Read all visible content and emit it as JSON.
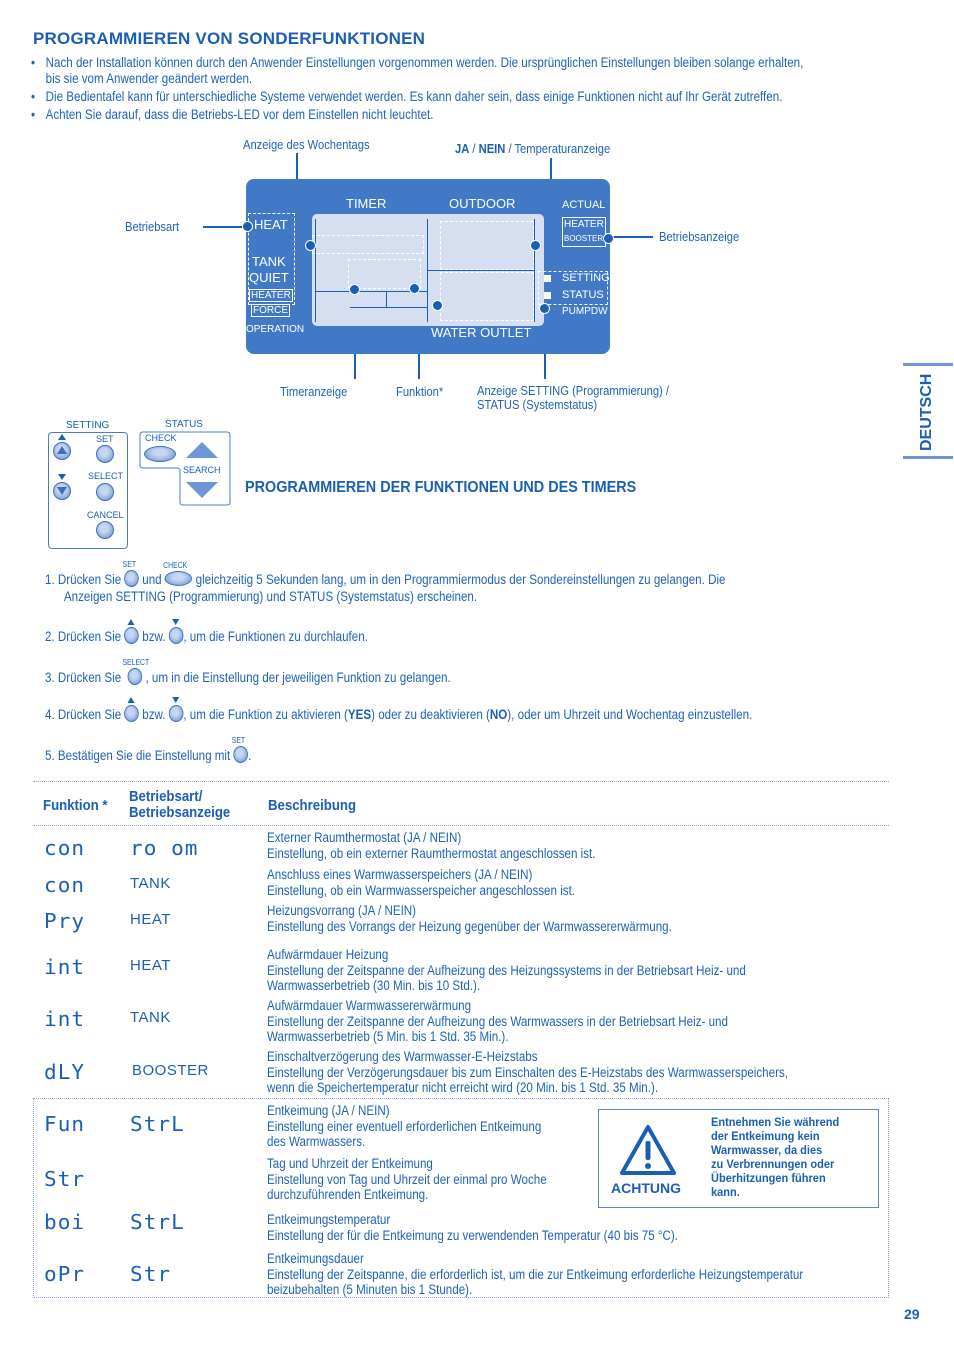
{
  "title": "PROGRAMMIEREN VON SONDERFUNKTIONEN",
  "bullets": [
    "Nach der Installation können durch den Anwender Einstellungen vorgenommen werden. Die ursprünglichen Einstellungen bleiben solange erhalten,",
    "bis sie vom Anwender geändert werden.",
    "Die Bedientafel kann für unterschiedliche Systeme verwendet werden. Es kann daher sein, dass einige Funktionen nicht auf Ihr Gerät zutreffen.",
    "Achten Sie darauf, dass die Betriebs-LED vor dem Einstellen nicht leuchtet."
  ],
  "diagram": {
    "callouts": {
      "weekday": "Anzeige des Wochentags",
      "yes_no_bold_ja": "JA",
      "yes_no_sep1": " / ",
      "yes_no_bold_nein": "NEIN",
      "yes_no_rest": " / Temperaturanzeige",
      "operation_mode": "Betriebsart",
      "operation_indicator": "Betriebsanzeige",
      "timer_display": "Timeranzeige",
      "function": "Funktion*",
      "setting_status_line1": "Anzeige SETTING (Programmierung) /",
      "setting_status_line2": "STATUS (Systemstatus)"
    },
    "lcd": {
      "timer": "TIMER",
      "outdoor": "OUTDOOR",
      "actual": "ACTUAL",
      "heat": "HEAT",
      "tank": "TANK",
      "quiet": "QUIET",
      "heater_left": "HEATER",
      "force": "FORCE",
      "operation": "OPERATION",
      "heater_right": "HEATER",
      "booster": "BOOSTER",
      "setting": "SETTING",
      "status": "STATUS",
      "pumpdw": "PUMPDW",
      "water_outlet": "WATER OUTLET"
    }
  },
  "buttons_panel": {
    "setting_title": "SETTING",
    "set": "SET",
    "select": "SELECT",
    "cancel": "CANCEL",
    "status_title": "STATUS",
    "check": "CHECK",
    "search": "SEARCH"
  },
  "subtitle": "PROGRAMMIEREN DER FUNKTIONEN UND DES TIMERS",
  "steps": {
    "s1_a": "1.  Drücken Sie",
    "s1_b": "und",
    "s1_c": "gleichzeitig 5 Sekunden lang, um in den Programmiermodus der Sondereinstellungen zu gelangen. Die",
    "s1_d": "Anzeigen SETTING (Programmierung) und STATUS (Systemstatus) erscheinen.",
    "s1_cap_set": "SET",
    "s1_cap_check": "CHECK",
    "s2_a": "2.  Drücken Sie",
    "s2_b": "bzw.",
    "s2_c": ", um die Funktionen zu durchlaufen.",
    "s3_a": "3.  Drücken Sie",
    "s3_cap": "SELECT",
    "s3_b": ", um in die Einstellung der jeweiligen Funktion zu gelangen.",
    "s4_a": "4.  Drücken Sie",
    "s4_b": "bzw.",
    "s4_c": ", um die Funktion zu aktivieren (",
    "s4_yes": "YES",
    "s4_d": ") oder zu deaktivieren (",
    "s4_no": "NO",
    "s4_e": "), oder um Uhrzeit und Wochentag einzustellen.",
    "s5_a": "5.  Bestätigen Sie die Einstellung mit",
    "s5_cap": "SET",
    "s5_b": "."
  },
  "table": {
    "headers": {
      "function": "Funktion *",
      "mode_line1": "Betriebsart/",
      "mode_line2": "Betriebsanzeige",
      "description": "Beschreibung"
    },
    "rows": [
      {
        "code": "con",
        "mode": "ro om",
        "mode_is_segment": true,
        "desc": "Externer Raumthermostat (JA / NEIN)\nEinstellung, ob ein externer Raumthermostat angeschlossen ist."
      },
      {
        "code": "con",
        "mode": "TANK",
        "desc": "Anschluss eines Warmwasserspeichers (JA / NEIN)\nEinstellung, ob ein Warmwasserspeicher angeschlossen ist."
      },
      {
        "code": "Pry",
        "mode": "HEAT",
        "desc": "Heizungsvorrang (JA / NEIN)\nEinstellung des Vorrangs der Heizung gegenüber der Warmwassererwärmung."
      },
      {
        "code": "int",
        "mode": "HEAT",
        "desc": "Aufwärmdauer Heizung\nEinstellung der Zeitspanne der Aufheizung des Heizungssystems in der Betriebsart Heiz- und\nWarmwasserbetrieb (30 Min. bis 10 Std.)."
      },
      {
        "code": "int",
        "mode": "TANK",
        "desc": "Aufwärmdauer Warmwassererwärmung\nEinstellung der Zeitspanne der Aufheizung des Warmwassers in der Betriebsart Heiz- und\nWarmwasserbetrieb (5 Min. bis 1 Std. 35 Min.)."
      },
      {
        "code": "dLY",
        "mode": "BOOSTER",
        "desc": "Einschaltverzögerung des Warmwasser-E-Heizstabs\nEinstellung der Verzögerungsdauer bis zum Einschalten des E-Heizstabs des Warmwasserspeichers,\nwenn die Speichertemperatur nicht erreicht wird (20 Min. bis 1 Std. 35 Min.)."
      },
      {
        "code": "Fun",
        "mode": "StrL",
        "mode_is_segment": true,
        "desc": "Entkeimung (JA / NEIN)\nEinstellung einer eventuell erforderlichen Entkeimung\ndes Warmwassers."
      },
      {
        "code": "Str",
        "mode": "",
        "desc": "Tag und Uhrzeit der Entkeimung\nEinstellung von Tag und Uhrzeit der einmal pro Woche\ndurchzuführenden Entkeimung."
      },
      {
        "code": "boi",
        "mode": "StrL",
        "mode_is_segment": true,
        "desc": "Entkeimungstemperatur\nEinstellung der für die Entkeimung zu verwendenden Temperatur (40 bis 75 °C)."
      },
      {
        "code": "oPr",
        "mode": "Str",
        "mode_is_segment": true,
        "desc": "Entkeimungsdauer\nEinstellung der Zeitspanne, die erforderlich ist, um die zur Entkeimung erforderliche Heizungstemperatur\nbeizubehalten (5 Minuten bis 1 Stunde)."
      }
    ]
  },
  "warning": {
    "label": "ACHTUNG",
    "text": "Entnehmen Sie während\nder Entkeimung kein\nWarmwasser, da dies\nzu Verbrennungen oder\nÜberhitzungen führen\nkann."
  },
  "language_tab": "DEUTSCH",
  "page_number": "29",
  "colors": {
    "brand_blue": "#1a5fb4",
    "lcd_blue": "#4279c6",
    "lcd_screen": "#d6dff0"
  }
}
